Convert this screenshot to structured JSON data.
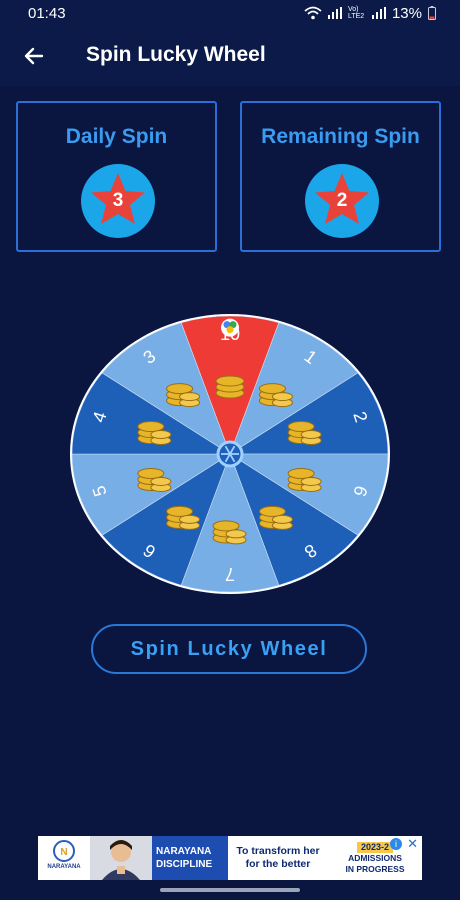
{
  "status": {
    "time": "01:43",
    "battery": "13%",
    "network_label": "Vo) LTE2"
  },
  "header": {
    "title": "Spin Lucky Wheel"
  },
  "cards": [
    {
      "title": "Daily Spin",
      "count": "3"
    },
    {
      "title": "Remaining Spin",
      "count": "2"
    }
  ],
  "wheel": {
    "segments": [
      "10",
      "1",
      "2",
      "6",
      "8",
      "7",
      "6",
      "5",
      "4",
      "3"
    ]
  },
  "spin_button": {
    "label": "Spin Lucky Wheel"
  },
  "ad": {
    "logo": "NARAYANA",
    "brand_line1": "NARAYANA",
    "brand_line2": "DISCIPLINE",
    "tag_line1": "To transform her",
    "tag_line2": "for the better",
    "year": "2023-2",
    "admissions": "ADMISSIONS",
    "progress": "IN PROGRESS"
  },
  "colors": {
    "background": "#0a1540",
    "accent": "#3a9cf0",
    "wheel_dark": "#1e5fb8",
    "wheel_light": "#78aee6",
    "wheel_highlight": "#ef3b35"
  }
}
